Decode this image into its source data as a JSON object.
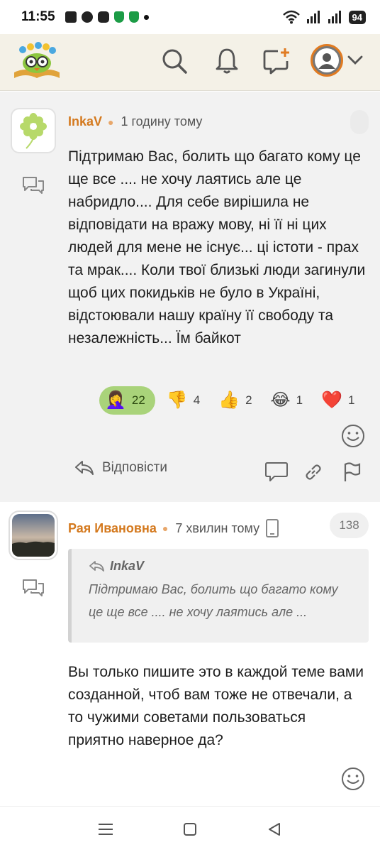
{
  "status_bar": {
    "time": "11:55",
    "battery": "94"
  },
  "colors": {
    "accent": "#d4791e",
    "reaction_active": "#a9d37a",
    "topbar_bg": "#f4f1e7"
  },
  "header": {
    "logo_icon": "owl-with-books-logo",
    "search_icon": "search-icon",
    "bell_icon": "bell-icon",
    "new_post_icon": "new-message-icon",
    "avatar_icon": "user-avatar-icon"
  },
  "comments": [
    {
      "author": "InkaV",
      "time": "1 годину тому",
      "text": "Підтримаю Вас, болить що багато кому це ще все .... не хочу лаятись але це набридло.... Для себе вирішила не відповідати на вражу мову, ні її ні цих людей для мене не існує... ці істоти - прах та мрак.... Коли твої близькі люди загинули щоб цих покидьків не було в Україні, відстоювали нашу країну її свободу та незалежність... Їм байкот",
      "reactions": [
        {
          "emoji": "🤦‍♀️",
          "count": "22",
          "active": true
        },
        {
          "emoji": "👎",
          "count": "4",
          "active": false
        },
        {
          "emoji": "👍",
          "count": "2",
          "active": false
        },
        {
          "emoji": "😂",
          "count": "1",
          "active": false
        },
        {
          "emoji": "❤️",
          "count": "1",
          "active": false
        }
      ],
      "reply_label": "Відповісти"
    },
    {
      "author": "Рая Ивановна",
      "time": "7 хвилин тому",
      "count": "138",
      "quote_author": "InkaV",
      "quote_text": "Підтримаю Вас, болить що багато кому це ще все .... не хочу лаятись але ...",
      "text": "Вы только пишите это в каждой теме вами созданной, чтоб вам тоже не отвечали, а то чужими советами пользоваться приятно наверное да?"
    }
  ]
}
